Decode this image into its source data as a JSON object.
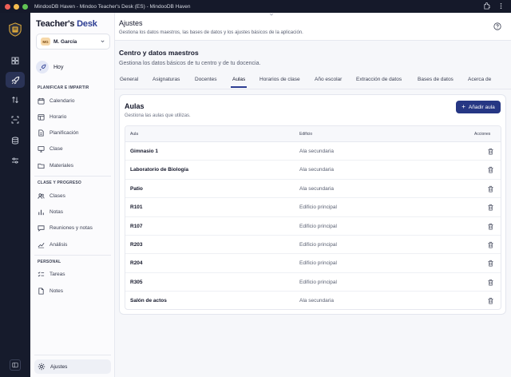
{
  "window": {
    "title": "MindooDB Haven - Mindoo Teacher's Desk (ES) - MindooDB Haven"
  },
  "brand": {
    "part1": "Teacher's ",
    "part2": "Desk"
  },
  "user": {
    "initials": "MG",
    "name": "M. García"
  },
  "sidebar": {
    "today": "Hoy",
    "sections": [
      {
        "label": "PLANIFICAR E IMPARTIR",
        "items": [
          "Calendario",
          "Horario",
          "Planificación",
          "Clase",
          "Materiales"
        ]
      },
      {
        "label": "CLASE Y PROGRESO",
        "items": [
          "Clases",
          "Notas",
          "Reuniones y notas",
          "Análisis"
        ]
      },
      {
        "label": "PERSONAL",
        "items": [
          "Tareas",
          "Notes"
        ]
      }
    ],
    "settings": "Ajustes"
  },
  "header": {
    "title": "Ajustes",
    "subtitle": "Gestiona los datos maestros, las bases de datos y los ajustes básicos de la aplicación."
  },
  "section": {
    "title": "Centro y datos maestros",
    "subtitle": "Gestiona los datos básicos de tu centro y de tu docencia."
  },
  "tabs": [
    "General",
    "Asignaturas",
    "Docentes",
    "Aulas",
    "Horarios de clase",
    "Año escolar",
    "Extracción de datos",
    "Bases de datos",
    "Acerca de"
  ],
  "active_tab": "Aulas",
  "card": {
    "title": "Aulas",
    "subtitle": "Gestiona las aulas que utilizas.",
    "add_button": "Añadir aula",
    "columns": [
      "Aula",
      "Edificio",
      "Acciones"
    ],
    "rows": [
      {
        "name": "Gimnasio 1",
        "building": "Ala secundaria"
      },
      {
        "name": "Laboratorio de Biología",
        "building": "Ala secundaria"
      },
      {
        "name": "Patio",
        "building": "Ala secundaria"
      },
      {
        "name": "R101",
        "building": "Edificio principal"
      },
      {
        "name": "R107",
        "building": "Edificio principal"
      },
      {
        "name": "R203",
        "building": "Edificio principal"
      },
      {
        "name": "R204",
        "building": "Edificio principal"
      },
      {
        "name": "R305",
        "building": "Edificio principal"
      },
      {
        "name": "Salón de actos",
        "building": "Ala secundaria"
      }
    ]
  }
}
